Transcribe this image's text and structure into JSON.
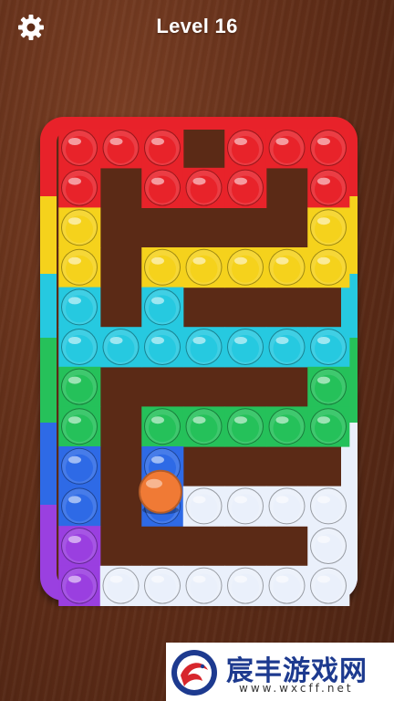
{
  "header": {
    "level_label": "Level 16",
    "settings_icon": "gear-icon"
  },
  "board": {
    "type": "pop-it maze",
    "ball_color": "#f07a35",
    "band_colors": {
      "red": "#e8232a",
      "yellow": "#f5d21c",
      "cyan": "#26c9e0",
      "green": "#25c15a",
      "blue": "#2e6ae6",
      "purple": "#9a3fe0",
      "white": "#eaf0fb"
    }
  },
  "watermark": {
    "name": "宸丰游戏网",
    "url": "www.wxcff.net"
  }
}
